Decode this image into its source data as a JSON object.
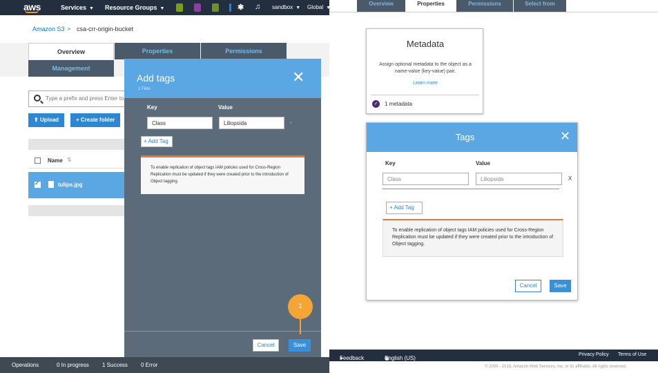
{
  "topnav": {
    "logo": "aws",
    "services": "Services",
    "resource_groups": "Resource Groups",
    "account": "sandbox",
    "region": "Global"
  },
  "breadcrumb": {
    "root": "Amazon S3",
    "separator": ">",
    "current": "csa-crr-origin-bucket"
  },
  "bucket_tabs": [
    "Overview",
    "Properties",
    "Permissions",
    "Management"
  ],
  "search": {
    "placeholder": "Type a prefix and press Enter to"
  },
  "actions": {
    "upload": "Upload",
    "create_folder": "Create folder"
  },
  "file_list": {
    "column_name": "Name",
    "files": [
      "tulips.jpg"
    ]
  },
  "status_bar": {
    "operations": "Operations",
    "in_progress": "0 In progress",
    "success": "1 Success",
    "error": "0 Error"
  },
  "add_tags_panel": {
    "title": "Add tags",
    "subtitle": "1 Files",
    "key_label": "Key",
    "value_label": "Value",
    "key_value": "Class",
    "value_value": "Liliopsida",
    "add_tag": "Add Tag",
    "note": "To enable replication of object tags IAM policies used for Cross-Region Replication must be updated if they were created prior to the introduction of Object tagging.",
    "cancel": "Cancel",
    "save": "Save"
  },
  "callout": {
    "number": "1"
  },
  "right_tabs": [
    "Overview",
    "Properties",
    "Permissions",
    "Select from"
  ],
  "metadata_card": {
    "title": "Metadata",
    "description": "Assign optional metadata to the object as a name-value (key-value) pair.",
    "learn_more": "Learn more",
    "count": "1 metadata"
  },
  "tags_card": {
    "title": "Tags",
    "key_label": "Key",
    "value_label": "Value",
    "key_placeholder": "Class",
    "value_placeholder": "Liliopsida",
    "remove": "X",
    "add_tag": "Add Tag",
    "note": "To enable replication of object tags IAM policies used for Cross-Region Replication must be updated if they were created prior to the introduction of Object tagging.",
    "cancel": "Cancel",
    "save": "Save"
  },
  "footer": {
    "feedback": "Feedback",
    "language": "English (US)",
    "privacy": "Privacy Policy",
    "terms": "Terms of Use",
    "copyright": "© 2008 - 2018, Amazon Web Services, Inc. or its affiliates. All rights reserved."
  },
  "colors": {
    "aws_nav": "#232f3e",
    "accent_blue": "#5aa7e3",
    "button_blue": "#2d87d2",
    "warning_orange": "#e07b39",
    "callout_orange": "#f4a536"
  }
}
